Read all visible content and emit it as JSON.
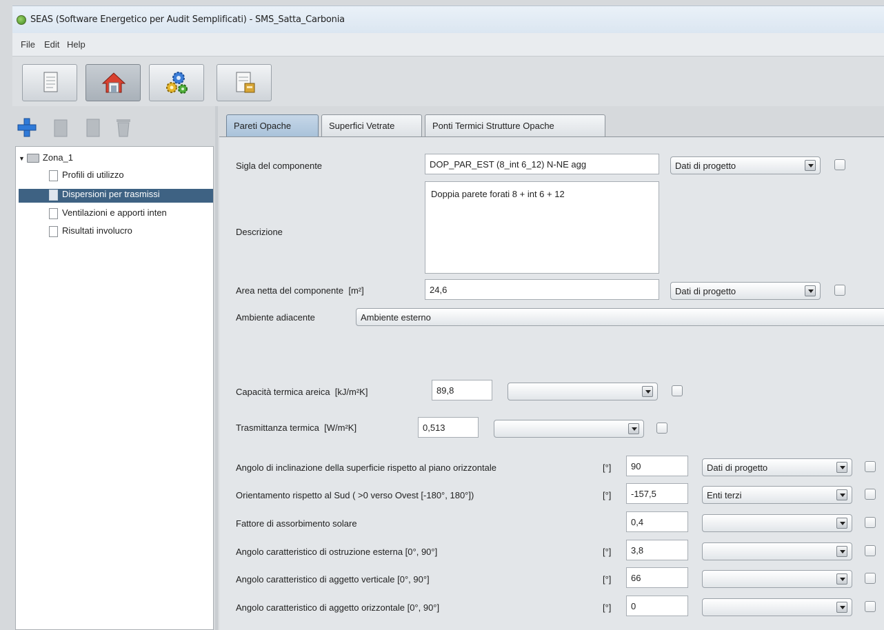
{
  "window": {
    "title": "SEAS (Software Energetico per Audit Semplificati) - SMS_Satta_Carbonia"
  },
  "menu": [
    "File",
    "Edit",
    "Help"
  ],
  "toolbar": {
    "buttons": [
      "document-icon",
      "house-icon",
      "gears-icon",
      "report-icon"
    ],
    "active": "house-icon"
  },
  "left_toolbar": [
    "add-icon",
    "copy-icon",
    "paste-icon",
    "delete-icon"
  ],
  "tree": {
    "root": "Zona_1",
    "items": [
      {
        "label": "Profili di utilizzo",
        "selected": false
      },
      {
        "label": "Dispersioni per trasmissi",
        "selected": true
      },
      {
        "label": "Ventilazioni e apporti inten",
        "selected": false
      },
      {
        "label": "Risultati involucro",
        "selected": false
      }
    ]
  },
  "tabs": [
    "Pareti Opache",
    "Superfici Vetrate",
    "Ponti Termici Strutture Opache"
  ],
  "form": {
    "sigla_label": "Sigla del componente",
    "sigla_value": "DOP_PAR_EST (8_int 6_12) N-NE agg",
    "sigla_source": "Dati di progetto",
    "descrizione_label": "Descrizione",
    "descrizione_value": "Doppia parete forati 8 + int 6 + 12",
    "area_label": "Area netta del componente",
    "area_unit": "[m²]",
    "area_value": "24,6",
    "area_source": "Dati di progetto",
    "ambiente_label": "Ambiente adiacente",
    "ambiente_value": "Ambiente esterno",
    "capacita_label": "Capacità termica areica",
    "capacita_unit": "[kJ/m²K]",
    "capacita_value": "89,8",
    "capacita_source": "",
    "trasmittanza_label": "Trasmittanza termica",
    "trasmittanza_unit": "[W/m²K]",
    "trasmittanza_value": "0,513",
    "trasmittanza_source": "",
    "rows": [
      {
        "label": "Angolo di inclinazione della superficie rispetto al piano orizzontale",
        "unit": "[°]",
        "value": "90",
        "source": "Dati di progetto"
      },
      {
        "label": "Orientamento rispetto al Sud ( >0 verso Ovest [-180°, 180°])",
        "unit": "[°]",
        "value": "-157,5",
        "source": "Enti terzi"
      },
      {
        "label": "Fattore di assorbimento solare",
        "unit": "",
        "value": "0,4",
        "source": ""
      },
      {
        "label": "Angolo caratteristico di ostruzione esterna [0°, 90°]",
        "unit": "[°]",
        "value": "3,8",
        "source": ""
      },
      {
        "label": "Angolo caratteristico di aggetto verticale [0°, 90°]",
        "unit": "[°]",
        "value": "66",
        "source": ""
      },
      {
        "label": "Angolo caratteristico di aggetto orizzontale [0°, 90°]",
        "unit": "[°]",
        "value": "0",
        "source": ""
      }
    ]
  }
}
